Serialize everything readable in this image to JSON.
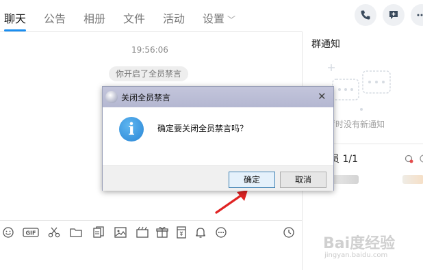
{
  "tabs": [
    {
      "label": "聊天"
    },
    {
      "label": "公告"
    },
    {
      "label": "相册"
    },
    {
      "label": "文件"
    },
    {
      "label": "活动"
    },
    {
      "label": "设置"
    }
  ],
  "chat": {
    "timestamp": "19:56:06",
    "system_message": "你开启了全员禁言"
  },
  "right_panel": {
    "notice_title": "群通知",
    "no_notice_text": "暂时没有新通知",
    "members_label": "员 1/1"
  },
  "dialog": {
    "title": "关闭全员禁言",
    "message": "确定要关闭全员禁言吗？",
    "ok_label": "确定",
    "cancel_label": "取消",
    "info_glyph": "i",
    "close_glyph": "✕"
  },
  "toolbar": {
    "gif_label": "GIF"
  },
  "watermark": {
    "main": "Bai度经验",
    "sub": "jingyan.baidu.com"
  },
  "colors": {
    "accent": "#1b8ef0",
    "arrow": "#e02424",
    "info_blue": "#2a86d6"
  }
}
